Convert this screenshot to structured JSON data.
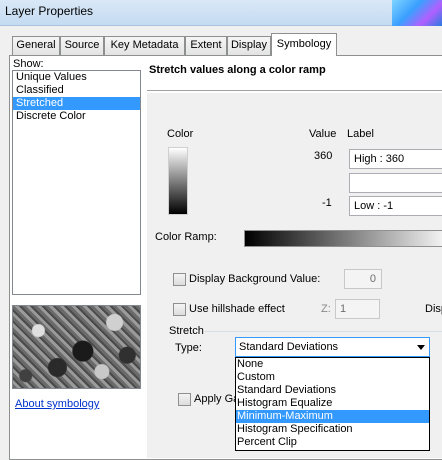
{
  "window": {
    "title": "Layer Properties"
  },
  "tabs": [
    {
      "label": "General"
    },
    {
      "label": "Source"
    },
    {
      "label": "Key Metadata"
    },
    {
      "label": "Extent"
    },
    {
      "label": "Display"
    },
    {
      "label": "Symbology",
      "active": true
    }
  ],
  "sidebar": {
    "show_label": "Show:",
    "items": [
      {
        "label": "Unique Values"
      },
      {
        "label": "Classified"
      },
      {
        "label": "Stretched",
        "selected": true
      },
      {
        "label": "Discrete Color"
      }
    ],
    "about_link": "About symbology"
  },
  "main": {
    "title": "Stretch values along a color ramp",
    "color_header": "Color",
    "value_header": "Value",
    "label_header": "Label",
    "high_value": "360",
    "high_label": "High : 360",
    "middle_label": "",
    "low_value": "-1",
    "low_label": "Low : -1",
    "color_ramp_label": "Color Ramp:",
    "display_background_label": "Display Background Value:",
    "background_value": "0",
    "hillshade_label": "Use hillshade effect",
    "z_label": "Z:",
    "z_value": "1",
    "disp_truncated": "Disp",
    "stretch_group_label": "Stretch",
    "type_label": "Type:",
    "type_selected": "Standard Deviations",
    "apply_gamma_label": "Apply Ga",
    "type_options": [
      {
        "label": "None"
      },
      {
        "label": "Custom"
      },
      {
        "label": "Standard Deviations"
      },
      {
        "label": "Histogram Equalize"
      },
      {
        "label": "Minimum-Maximum",
        "highlighted": true
      },
      {
        "label": "Histogram Specification"
      },
      {
        "label": "Percent Clip"
      }
    ]
  },
  "colors": {
    "selection": "#3399ff",
    "link": "#0033cc",
    "titlebar": "#d9e8f7"
  }
}
